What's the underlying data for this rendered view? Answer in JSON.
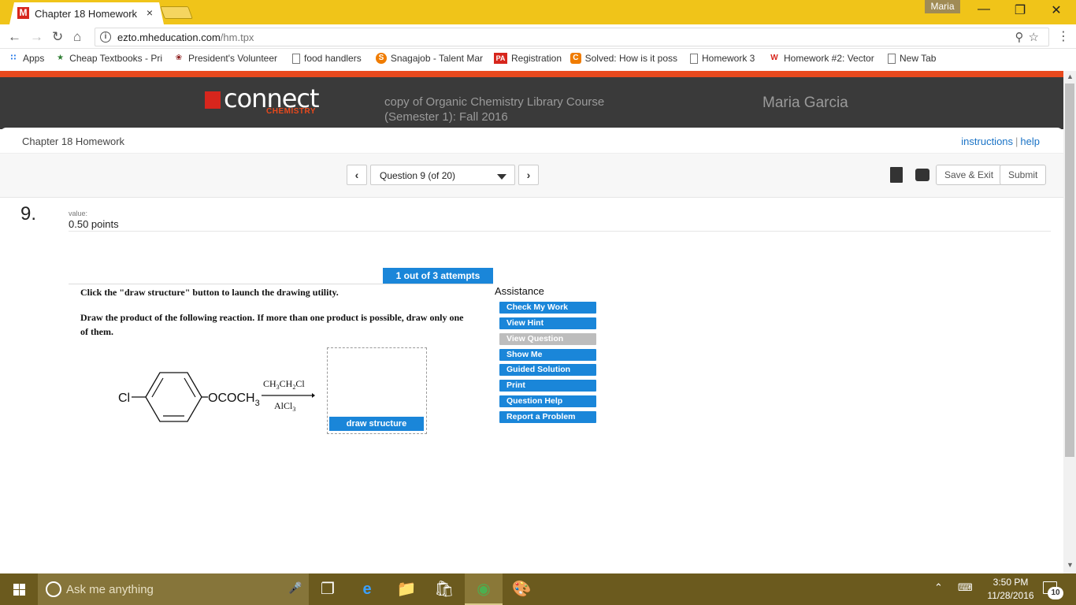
{
  "browser": {
    "tab_title": "Chapter 18 Homework",
    "tab_close": "×",
    "profile_name": "Maria",
    "url_host": "ezto.mheducation.com",
    "url_path": "/hm.tpx",
    "bookmarks": [
      {
        "label": "Apps",
        "icon": "apps-grid-icon"
      },
      {
        "label": "Cheap Textbooks - Pri",
        "icon": "textbook-icon"
      },
      {
        "label": "President's Volunteer",
        "icon": "eagle-icon"
      },
      {
        "label": "food handlers",
        "icon": "page-icon"
      },
      {
        "label": "Snagajob - Talent Mar",
        "icon": "snagajob-icon"
      },
      {
        "label": "Registration",
        "icon": "pa-icon"
      },
      {
        "label": "Solved: How is it poss",
        "icon": "chegg-icon"
      },
      {
        "label": "Homework 3",
        "icon": "page-icon"
      },
      {
        "label": "Homework #2: Vector",
        "icon": "webassign-icon"
      },
      {
        "label": "New Tab",
        "icon": "page-icon"
      }
    ]
  },
  "header": {
    "logo_word": "connect",
    "logo_sub": "CHEMISTRY",
    "course_line1": "copy of Organic Chemistry Library Course",
    "course_line2": "(Semester 1): Fall 2016",
    "user_name": "Maria Garcia"
  },
  "subheader": {
    "breadcrumb": "Chapter 18 Homework",
    "instructions_link": "instructions",
    "separator": "|",
    "help_link": "help"
  },
  "qnav": {
    "prev": "‹",
    "next": "›",
    "selected_question": "Question 9 (of 20)",
    "save_exit": "Save & Exit",
    "submit": "Submit"
  },
  "question": {
    "number": "9.",
    "value_label": "value:",
    "points": "0.50 points",
    "attempts": "1 out of 3 attempts",
    "instruction1": "Click the \"draw structure\" button to launch the drawing utility.",
    "instruction2_line1": "Draw the product of the following reaction. If more than one product is possible, draw only one",
    "instruction2_line2": "of them.",
    "reactant_left": "Cl",
    "reactant_right": "OCOCH",
    "reactant_right_sub": "3",
    "reagent_top": "CH",
    "reagent_bottom": "AlCl",
    "draw_button": "draw structure"
  },
  "assistance": {
    "title": "Assistance",
    "buttons": [
      {
        "label": "Check My Work",
        "enabled": true
      },
      {
        "label": "View Hint",
        "enabled": true
      },
      {
        "label": "View Question",
        "enabled": false
      },
      {
        "label": "Show Me",
        "enabled": true
      },
      {
        "label": "Guided Solution",
        "enabled": true
      },
      {
        "label": "Print",
        "enabled": true
      },
      {
        "label": "Question Help",
        "enabled": true
      },
      {
        "label": "Report a Problem",
        "enabled": true
      }
    ]
  },
  "taskbar": {
    "search_placeholder": "Ask me anything",
    "time": "3:50 PM",
    "date": "11/28/2016",
    "notification_count": "10"
  },
  "colors": {
    "accent_blue": "#1a86d9",
    "brand_orange": "#e8491d",
    "chrome_yellow": "#f0c419",
    "header_dark": "#3a3a3a"
  }
}
